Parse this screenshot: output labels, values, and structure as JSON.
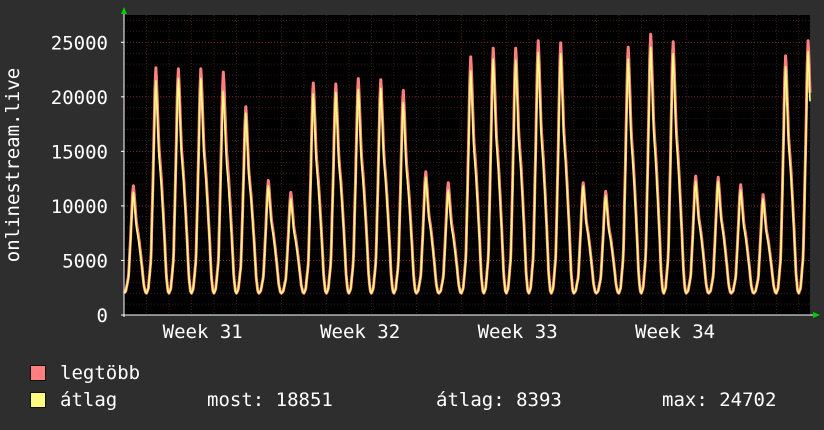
{
  "chart_data": {
    "type": "area",
    "ylabel": "onlinestream.live",
    "ylim": [
      0,
      27500
    ],
    "yticks": [
      0,
      5000,
      10000,
      15000,
      20000,
      25000
    ],
    "xticks": [
      {
        "label": "Week 31",
        "day": 3.5
      },
      {
        "label": "Week 32",
        "day": 10.5
      },
      {
        "label": "Week 33",
        "day": 17.5
      },
      {
        "label": "Week 34",
        "day": 24.5
      }
    ],
    "xlim_days": [
      0,
      30.5
    ],
    "series": [
      {
        "name": "legtöbb",
        "color": "#ff7f7f",
        "daily_peaks": [
          11900,
          22800,
          22700,
          22700,
          22400,
          19200,
          12400,
          11300,
          21400,
          21300,
          21800,
          21700,
          20700,
          13200,
          12200,
          23800,
          24600,
          24600,
          25300,
          25100,
          12200,
          11400,
          24700,
          25900,
          25200,
          12800,
          12700,
          12000,
          11100,
          23900,
          25300
        ],
        "last": 20000
      },
      {
        "name": "átlag",
        "color": "#ffff7f",
        "daily_peaks": [
          11300,
          21600,
          21800,
          21800,
          20600,
          18600,
          11900,
          10700,
          20400,
          20500,
          20800,
          20900,
          19600,
          12700,
          11500,
          22500,
          23600,
          23500,
          24200,
          24100,
          11900,
          11000,
          23600,
          24700,
          24100,
          12300,
          12300,
          11500,
          10700,
          22900,
          24300
        ],
        "last": 18851
      }
    ],
    "grid": true,
    "legend": "bottom-left"
  },
  "legend": {
    "items": [
      {
        "label": "legtöbb",
        "color": "#ff7f7f"
      },
      {
        "label": "átlag",
        "color": "#ffff7f"
      }
    ]
  },
  "stats": {
    "most": "most: 18851",
    "avg": "átlag: 8393",
    "max": "max: 24702"
  }
}
